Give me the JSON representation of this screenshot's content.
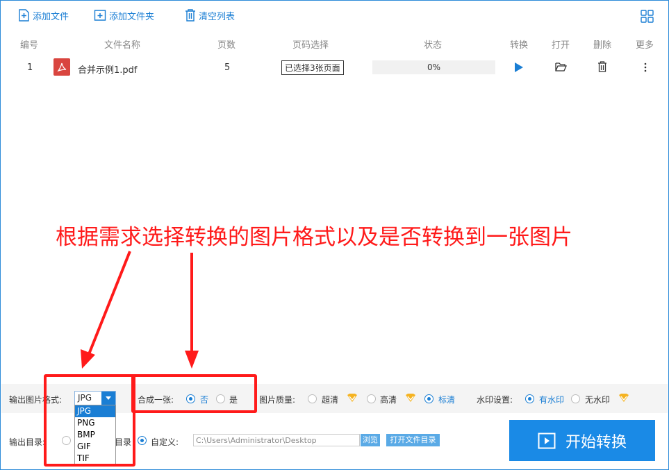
{
  "toolbar": {
    "add_file": "添加文件",
    "add_folder": "添加文件夹",
    "clear_list": "清空列表"
  },
  "table": {
    "headers": {
      "index": "编号",
      "filename": "文件名称",
      "pages": "页数",
      "page_select": "页码选择",
      "status": "状态",
      "convert": "转换",
      "open": "打开",
      "delete": "删除",
      "more": "更多"
    },
    "rows": [
      {
        "index": "1",
        "filename": "合并示例1.pdf",
        "pages": "5",
        "page_select": "已选择3张页面",
        "progress": "0%"
      }
    ]
  },
  "annotation": {
    "text": "根据需求选择转换的图片格式以及是否转换到一张图片"
  },
  "settings": {
    "format_label": "输出图片格式:",
    "format_value": "JPG",
    "format_options": [
      "JPG",
      "PNG",
      "BMP",
      "GIF",
      "TIF"
    ],
    "merge_label": "合成一张:",
    "merge_no": "否",
    "merge_yes": "是",
    "quality_label": "图片质量:",
    "quality_ultra": "超清",
    "quality_high": "高清",
    "quality_std": "标清",
    "watermark_label": "水印设置:",
    "watermark_on": "有水印",
    "watermark_off": "无水印"
  },
  "output": {
    "dir_label": "输出目录:",
    "same_dir_tail": "目录",
    "custom_label": "自定义:",
    "path": "C:\\Users\\Administrator\\Desktop",
    "browse": "浏览",
    "open_dir": "打开文件目录",
    "start": "开始转换"
  },
  "colors": {
    "accent": "#1a7ed4",
    "annotation": "#ff1a1a",
    "vip": "#f5b321"
  }
}
